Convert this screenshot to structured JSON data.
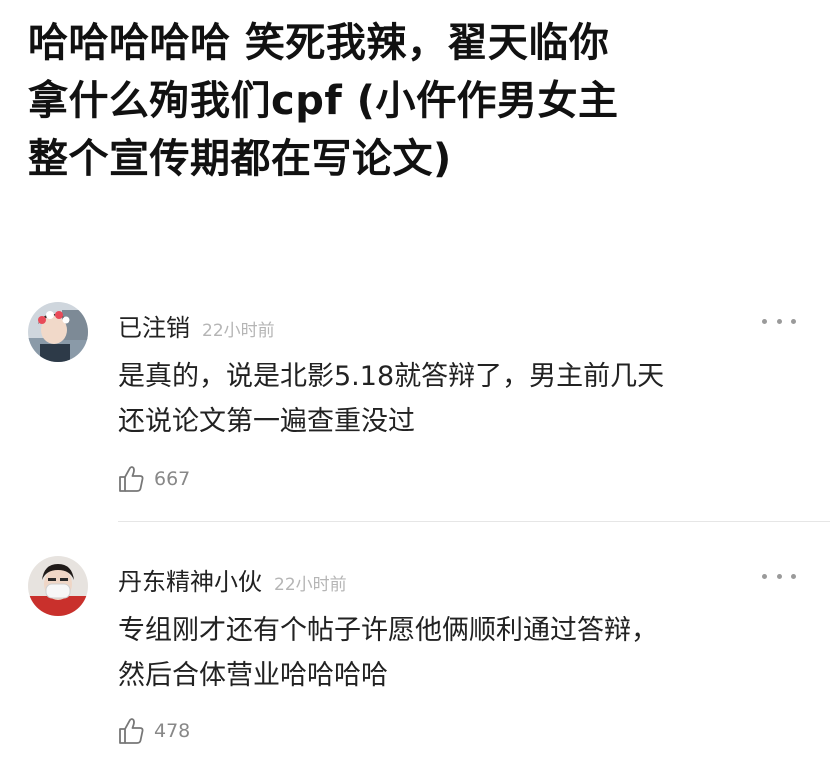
{
  "post": {
    "title_lines": [
      "哈哈哈哈哈 笑死我辣，翟天临你",
      "拿什么殉我们cpf (小仵作男女主",
      "整个宣传期都在写论文)"
    ]
  },
  "comments": [
    {
      "username": "已注销",
      "time": "22小时前",
      "body_lines": [
        "是真的，说是北影5.18就答辩了，男主前几天",
        "还说论文第一遍查重没过"
      ],
      "likes": "667",
      "avatar_icon": "user-avatar-photo"
    },
    {
      "username": "丹东精神小伙",
      "time": "22小时前",
      "body_lines": [
        "专组刚才还有个帖子许愿他俩顺利通过答辩，",
        "然后合体营业哈哈哈哈"
      ],
      "likes": "478",
      "avatar_icon": "user-avatar-photo"
    }
  ],
  "icons": {
    "more": "more-dots-icon",
    "like": "thumbs-up-icon"
  }
}
